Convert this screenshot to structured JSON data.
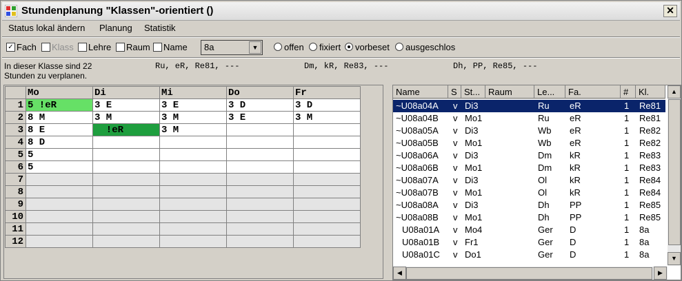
{
  "window": {
    "title": "Stundenplanung \"Klassen\"-orientiert ()",
    "close": "✕"
  },
  "menu": [
    "Status lokal ändern",
    "Planung",
    "Statistik"
  ],
  "filters": {
    "fach": {
      "label": "Fach",
      "checked": true
    },
    "klasse": {
      "label": "Klass",
      "checked": false
    },
    "lehrer": {
      "label": "Lehre",
      "checked": false
    },
    "raum": {
      "label": "Raum",
      "checked": false
    },
    "name": {
      "label": "Name",
      "checked": false
    },
    "class_select": "8a",
    "status_options": [
      {
        "label": "offen",
        "selected": false
      },
      {
        "label": "fixiert",
        "selected": false
      },
      {
        "label": "vorbeset",
        "selected": true
      },
      {
        "label": "ausgeschlos",
        "selected": false
      }
    ]
  },
  "info": {
    "line1": "In dieser Klasse sind 22",
    "line2": "Stunden zu verplanen.",
    "col1": "Ru, eR, Re81, ---",
    "col2": "Dm, kR, Re83, ---",
    "col3": "Dh, PP, Re85, ---"
  },
  "timetable": {
    "days": [
      "Mo",
      "Di",
      "Mi",
      "Do",
      "Fr"
    ],
    "rows": [
      {
        "n": "1",
        "cells": [
          "5 !eR",
          "3 E",
          "3 E",
          "3 D",
          "3 D"
        ]
      },
      {
        "n": "2",
        "cells": [
          "8 M",
          "3 M",
          "3 M",
          "3 E",
          "3 M"
        ]
      },
      {
        "n": "3",
        "cells": [
          "8 E",
          "  !eR",
          "3 M",
          "",
          ""
        ]
      },
      {
        "n": "4",
        "cells": [
          "8 D",
          "",
          "",
          "",
          ""
        ]
      },
      {
        "n": "5",
        "cells": [
          "5",
          "",
          "",
          "",
          ""
        ]
      },
      {
        "n": "6",
        "cells": [
          "5",
          "",
          "",
          "",
          ""
        ]
      },
      {
        "n": "7",
        "cells": [
          "",
          "",
          "",
          "",
          ""
        ]
      },
      {
        "n": "8",
        "cells": [
          "",
          "",
          "",
          "",
          ""
        ]
      },
      {
        "n": "9",
        "cells": [
          "",
          "",
          "",
          "",
          ""
        ]
      },
      {
        "n": "10",
        "cells": [
          "",
          "",
          "",
          "",
          ""
        ]
      },
      {
        "n": "11",
        "cells": [
          "",
          "",
          "",
          "",
          ""
        ]
      },
      {
        "n": "12",
        "cells": [
          "",
          "",
          "",
          "",
          ""
        ]
      }
    ]
  },
  "list": {
    "columns": [
      "Name",
      "S",
      "St...",
      "Raum",
      "Le...",
      "Fa.",
      "#",
      "Kl."
    ],
    "rows": [
      [
        "~U08a04A",
        "v",
        "Di3",
        "",
        "Ru",
        "eR",
        "1",
        "Re81"
      ],
      [
        "~U08a04B",
        "v",
        "Mo1",
        "",
        "Ru",
        "eR",
        "1",
        "Re81"
      ],
      [
        "~U08a05A",
        "v",
        "Di3",
        "",
        "Wb",
        "eR",
        "1",
        "Re82"
      ],
      [
        "~U08a05B",
        "v",
        "Mo1",
        "",
        "Wb",
        "eR",
        "1",
        "Re82"
      ],
      [
        "~U08a06A",
        "v",
        "Di3",
        "",
        "Dm",
        "kR",
        "1",
        "Re83"
      ],
      [
        "~U08a06B",
        "v",
        "Mo1",
        "",
        "Dm",
        "kR",
        "1",
        "Re83"
      ],
      [
        "~U08a07A",
        "v",
        "Di3",
        "",
        "Ol",
        "kR",
        "1",
        "Re84"
      ],
      [
        "~U08a07B",
        "v",
        "Mo1",
        "",
        "Ol",
        "kR",
        "1",
        "Re84"
      ],
      [
        "~U08a08A",
        "v",
        "Di3",
        "",
        "Dh",
        "PP",
        "1",
        "Re85"
      ],
      [
        "~U08a08B",
        "v",
        "Mo1",
        "",
        "Dh",
        "PP",
        "1",
        "Re85"
      ],
      [
        "U08a01A",
        "v",
        "Mo4",
        "",
        "Ger",
        "D",
        "1",
        "8a"
      ],
      [
        "U08a01B",
        "v",
        "Fr1",
        "",
        "Ger",
        "D",
        "1",
        "8a"
      ],
      [
        "U08a01C",
        "v",
        "Do1",
        "",
        "Ger",
        "D",
        "1",
        "8a"
      ]
    ],
    "selected_row": 0
  }
}
